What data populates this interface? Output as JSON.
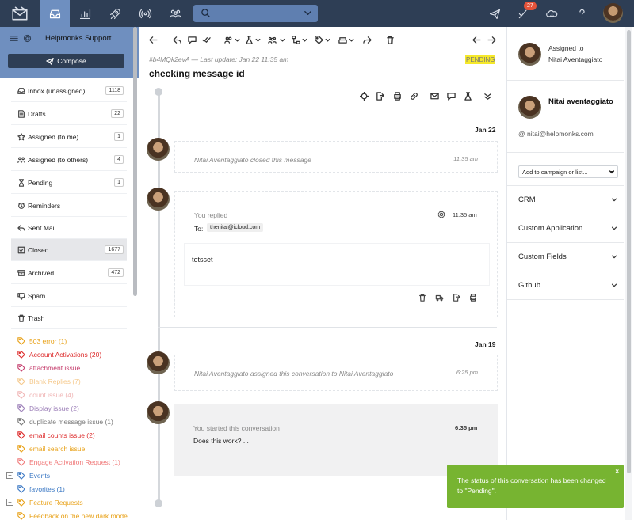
{
  "topbar": {
    "nav": [
      "mail-logo",
      "inbox",
      "reports",
      "rocket",
      "broadcast",
      "team"
    ],
    "search_placeholder": "",
    "tasks_badge": "27"
  },
  "sidebar": {
    "mailbox_name": "Helpmonks Support",
    "compose_label": "Compose",
    "folders": [
      {
        "label": "Inbox (unassigned)",
        "count": "1118",
        "icon": "inbox-icon"
      },
      {
        "label": "Drafts",
        "count": "22",
        "icon": "drafts-icon"
      },
      {
        "label": "Assigned (to me)",
        "count": "1",
        "icon": "star-icon"
      },
      {
        "label": "Assigned (to others)",
        "count": "4",
        "icon": "group-icon"
      },
      {
        "label": "Pending",
        "count": "1",
        "icon": "hourglass-icon"
      },
      {
        "label": "Reminders",
        "count": "",
        "icon": "reminder-icon"
      },
      {
        "label": "Sent Mail",
        "count": "",
        "icon": "reply-icon"
      },
      {
        "label": "Closed",
        "count": "1677",
        "icon": "checkbox-icon"
      },
      {
        "label": "Archived",
        "count": "472",
        "icon": "archive-icon"
      },
      {
        "label": "Spam",
        "count": "",
        "icon": "thumbs-down-icon"
      },
      {
        "label": "Trash",
        "count": "",
        "icon": "trash-icon"
      }
    ],
    "tags": [
      {
        "label": "503 error (1)",
        "color": "#e8a117"
      },
      {
        "label": "Account Activations (20)",
        "color": "#dd2b2b"
      },
      {
        "label": "attachment issue",
        "color": "#c43a6a"
      },
      {
        "label": "Blank Replies (7)",
        "color": "#f5c98c"
      },
      {
        "label": "count issue (4)",
        "color": "#f0b5b5"
      },
      {
        "label": "Display issue (2)",
        "color": "#9c7fb8"
      },
      {
        "label": "duplicate message issue (1)",
        "color": "#777777"
      },
      {
        "label": "email counts issue (2)",
        "color": "#dd2b2b"
      },
      {
        "label": "email search issue",
        "color": "#e8a117"
      },
      {
        "label": "Engage Activation Request (1)",
        "color": "#f07a7a"
      },
      {
        "label": "Events",
        "color": "#3b78c4"
      },
      {
        "label": "favorites (1)",
        "color": "#3b78c4"
      },
      {
        "label": "Feature Requests",
        "color": "#e8a117"
      },
      {
        "label": "Feedback on the new dark mode",
        "color": "#e8a117"
      }
    ]
  },
  "conversation": {
    "id_line": "#b4MQk2evA — Last update: Jan 22 11:35 am",
    "status": "PENDING",
    "subject": "checking message id",
    "timeline": [
      {
        "type": "date",
        "label": "Jan 22"
      },
      {
        "type": "event",
        "text": "Nitai Aventaggiato closed this message",
        "time": "11:35 am"
      },
      {
        "type": "reply",
        "title": "You replied",
        "time": "11:35 am",
        "to_label": "To:",
        "to": "thenitai@icloud.com",
        "body": "tetsset"
      },
      {
        "type": "date",
        "label": "Jan 19"
      },
      {
        "type": "event",
        "text": "Nitai Aventaggiato assigned this conversation to Nitai Aventaggiato",
        "time": "6:25 pm"
      },
      {
        "type": "start",
        "title": "You started this conversation",
        "time": "6:35 pm",
        "body": "Does this work? ..."
      }
    ]
  },
  "right": {
    "assigned_label": "Assigned to",
    "assigned_name": "Nitai Aventaggiato",
    "contact_name": "Nitai aventaggiato",
    "contact_email": "@ nitai@helpmonks.com",
    "campaign_select": "Add to campaign or list...",
    "sections": [
      "CRM",
      "Custom Application",
      "Custom Fields",
      "Github"
    ]
  },
  "toast": {
    "message": "The status of this conversation has been changed to \"Pending\".",
    "close": "×",
    "color": "#77b431"
  }
}
